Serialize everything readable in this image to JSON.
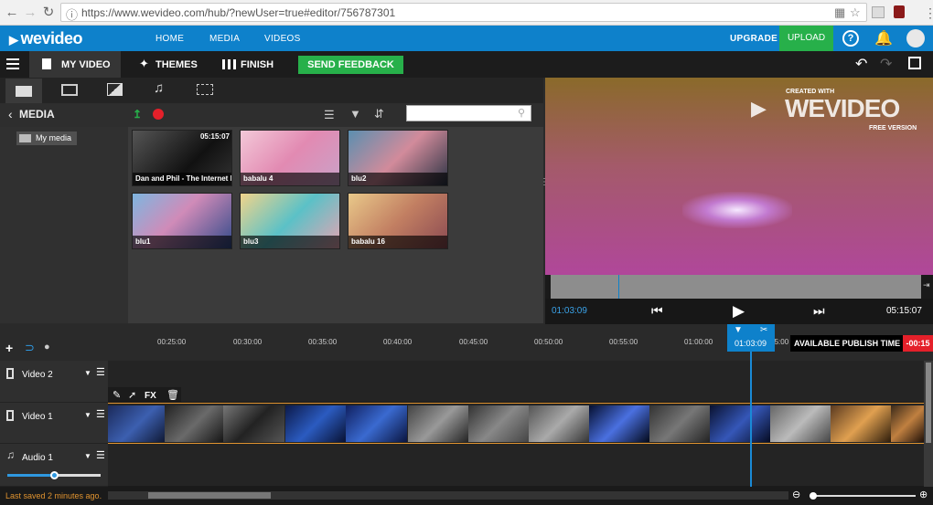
{
  "browser": {
    "url": "https://www.wevideo.com/hub/?newUser=true#editor/756787301",
    "icons": [
      "back-icon",
      "forward-icon",
      "reload-icon",
      "lock-icon",
      "translate-icon",
      "star-icon",
      "extension-icon",
      "user-icon",
      "menu-icon"
    ]
  },
  "appnav": {
    "logo": "wevideo",
    "links": [
      "HOME",
      "MEDIA",
      "VIDEOS"
    ],
    "upgrade": "UPGRADE",
    "upload": "UPLOAD"
  },
  "toolbar": {
    "my_video": "MY VIDEO",
    "themes": "THEMES",
    "finish": "FINISH",
    "feedback": "SEND FEEDBACK"
  },
  "media": {
    "header": "MEDIA",
    "search_placeholder": "",
    "folder": "My media",
    "items": [
      {
        "label": "Dan and Phil - The Internet I...",
        "duration": "05:15:07"
      },
      {
        "label": "babalu 4",
        "duration": ""
      },
      {
        "label": "blu2",
        "duration": ""
      },
      {
        "label": "blu1",
        "duration": ""
      },
      {
        "label": "blu3",
        "duration": ""
      },
      {
        "label": "babalu 16",
        "duration": ""
      }
    ]
  },
  "preview": {
    "watermark_top": "CREATED WITH",
    "watermark_logo": "WEVIDEO",
    "watermark_bottom": "FREE VERSION",
    "current_time": "01:03:09",
    "total_time": "05:15:07"
  },
  "timeline": {
    "ticks": [
      "00:25:00",
      "00:30:00",
      "00:35:00",
      "00:40:00",
      "00:45:00",
      "00:50:00",
      "00:55:00",
      "01:00:00",
      "01:05:00"
    ],
    "playhead_time": "01:03:09",
    "publish_label": "AVAILABLE PUBLISH TIME",
    "publish_time": "-00:15",
    "clip_tools": {
      "fx": "FX"
    },
    "tracks": [
      {
        "name": "Video 2"
      },
      {
        "name": "Video 1"
      },
      {
        "name": "Audio 1"
      }
    ],
    "audio_volume": 0.5
  },
  "status": {
    "saved": "Last saved 2 minutes ago."
  },
  "colors": {
    "brand_blue": "#0e81cb",
    "green": "#27b04a",
    "red": "#e4202a",
    "status_orange": "#e0932f"
  }
}
